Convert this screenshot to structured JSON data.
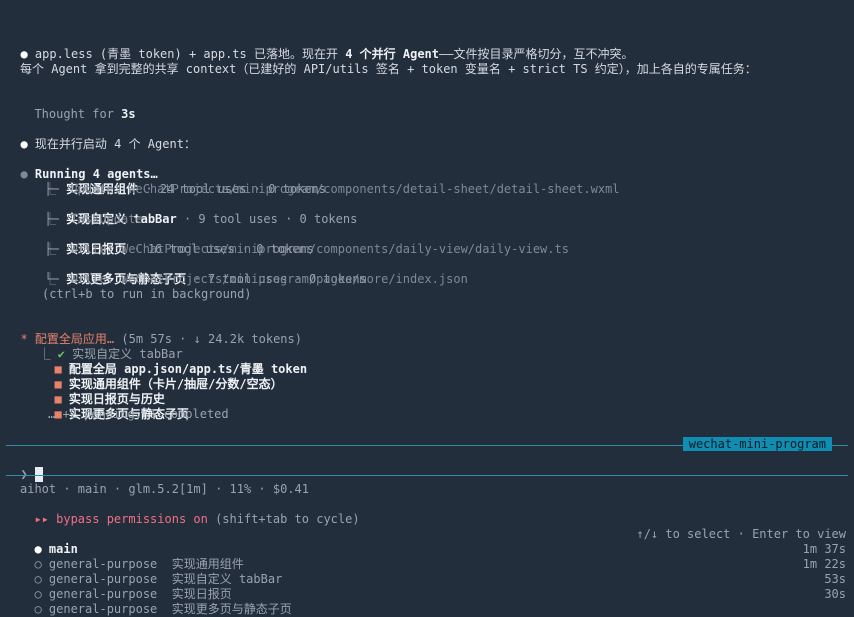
{
  "msg1": {
    "bullet": "●",
    "prefix": " app.less (青墨 token) + app.ts 已落地。现在开 ",
    "count": "4 个并行 Agent",
    "suffix": "——文件按目录严格切分，互不冲突。"
  },
  "msg2": "每个 Agent 拿到完整的共享 context（已建好的 API/utils 签名 + token 变量名 + strict TS 约定），加上各自的专属任务：",
  "thought": {
    "label": "Thought for ",
    "value": "3s"
  },
  "msg3": {
    "bullet": "●",
    "text": " 现在并行启动 4 个 Agent："
  },
  "running": {
    "bullet": "●",
    "title": "Running 4 agents…"
  },
  "agents": [
    {
      "branch": "├─",
      "name": "实现通用组件",
      "stats": " · 24 tool uses · 0 tokens",
      "sub": "⎿  Update: WeChatProjects/miniprogram/components/detail-sheet/detail-sheet.wxml"
    },
    {
      "branch": "├─",
      "name": "实现自定义 tabBar",
      "stats": " · 9 tool uses · 0 tokens",
      "sub": "⎿  TaskUpdate"
    },
    {
      "branch": "├─",
      "name": "实现日报页",
      "stats": " · 16 tool uses · 0 tokens",
      "sub": "⎿  Write: WeChatProjects/miniprogram/components/daily-view/daily-view.ts"
    },
    {
      "branch": "└─",
      "name": "实现更多页与静态子页",
      "stats": " · 7 tool uses · 0 tokens",
      "sub": "⎿  Write: WeChatProjects/miniprogram/pages/more/index.json"
    }
  ],
  "background_hint": "(ctrl+b to run in background)",
  "status": {
    "star": "*",
    "title": " 配置全局应用…",
    "meta": " (5m 57s · ↓ 24.2k tokens)",
    "done": {
      "branch": "⎿ ",
      "check": "✔",
      "text": " 实现自定义 tabBar"
    },
    "pending": [
      {
        "icon": "■",
        "text": " 配置全局 app.json/app.ts/青墨 token"
      },
      {
        "icon": "■",
        "text": " 实现通用组件（卡片/抽屉/分数/空态）"
      },
      {
        "icon": "■",
        "text": " 实现日报页与历史"
      },
      {
        "icon": "■",
        "text": " 实现更多页与静态子页"
      }
    ],
    "more": "… +2 pending, 1 completed"
  },
  "project_tag": "wechat-mini-program",
  "prompt_symbol": "❯",
  "footer": {
    "info": "aihot · main · glm.5.2[1m] · 11% · $0.41",
    "perm_arrows": "▸▸",
    "perm_text": " bypass permissions on",
    "perm_hint": " (shift+tab to cycle)"
  },
  "tasks": {
    "main": {
      "bullet": "●",
      "label": " main"
    },
    "hint": "↑/↓ to select · Enter to view",
    "items": [
      {
        "icon": "○",
        "type": " general-purpose",
        "name": "  实现通用组件",
        "time": "1m 37s"
      },
      {
        "icon": "○",
        "type": " general-purpose",
        "name": "  实现自定义 tabBar",
        "time": "1m 22s"
      },
      {
        "icon": "○",
        "type": " general-purpose",
        "name": "  实现日报页",
        "time": "53s"
      },
      {
        "icon": "○",
        "type": " general-purpose",
        "name": "  实现更多页与静态子页",
        "time": "30s"
      }
    ]
  },
  "colors": {
    "background": "#232e3c",
    "accent_teal": "#0f8db3",
    "orange": "#e8826b",
    "green": "#6cc46c",
    "pink": "#f07080"
  }
}
